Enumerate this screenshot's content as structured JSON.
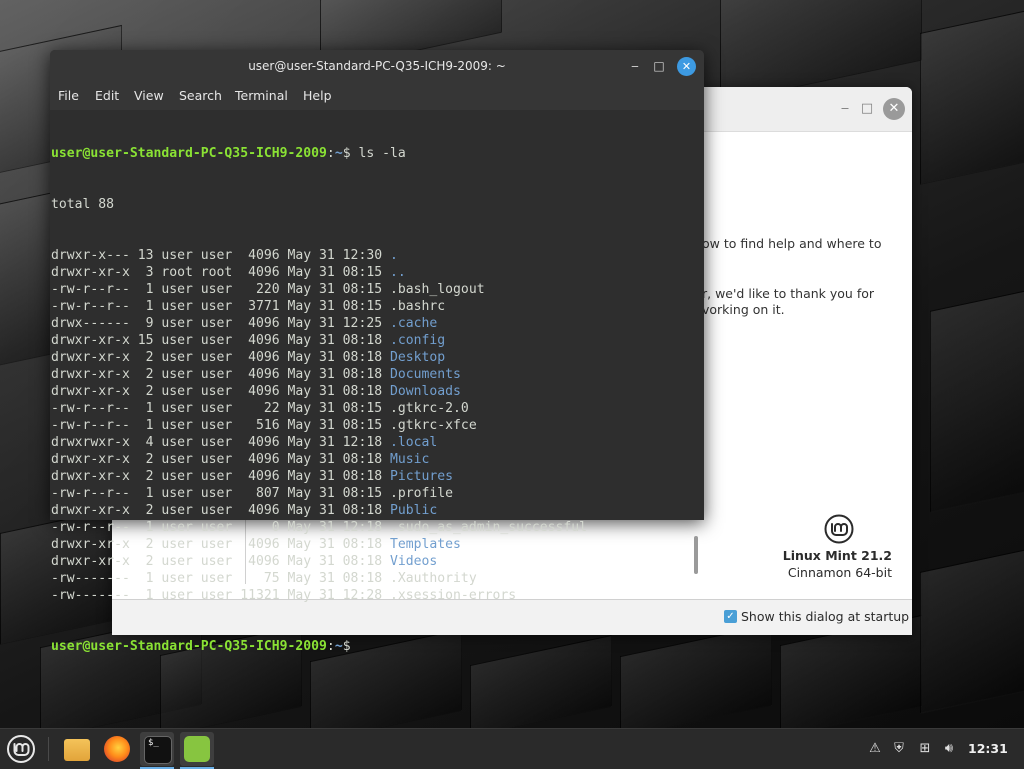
{
  "terminal": {
    "title": "user@user-Standard-PC-Q35-ICH9-2009: ~",
    "menu": [
      "File",
      "Edit",
      "View",
      "Search",
      "Terminal",
      "Help"
    ],
    "prompt_user": "user@user-Standard-PC-Q35-ICH9-2009",
    "prompt_path": "~",
    "command": "ls -la",
    "total": "total 88",
    "listing": [
      {
        "meta": "drwxr-x--- 13 user user  4096 May 31 12:30 ",
        "name": ".",
        "dir": true
      },
      {
        "meta": "drwxr-xr-x  3 root root  4096 May 31 08:15 ",
        "name": "..",
        "dir": true
      },
      {
        "meta": "-rw-r--r--  1 user user   220 May 31 08:15 ",
        "name": ".bash_logout",
        "dir": false
      },
      {
        "meta": "-rw-r--r--  1 user user  3771 May 31 08:15 ",
        "name": ".bashrc",
        "dir": false
      },
      {
        "meta": "drwx------  9 user user  4096 May 31 12:25 ",
        "name": ".cache",
        "dir": true
      },
      {
        "meta": "drwxr-xr-x 15 user user  4096 May 31 08:18 ",
        "name": ".config",
        "dir": true
      },
      {
        "meta": "drwxr-xr-x  2 user user  4096 May 31 08:18 ",
        "name": "Desktop",
        "dir": true
      },
      {
        "meta": "drwxr-xr-x  2 user user  4096 May 31 08:18 ",
        "name": "Documents",
        "dir": true
      },
      {
        "meta": "drwxr-xr-x  2 user user  4096 May 31 08:18 ",
        "name": "Downloads",
        "dir": true
      },
      {
        "meta": "-rw-r--r--  1 user user    22 May 31 08:15 ",
        "name": ".gtkrc-2.0",
        "dir": false
      },
      {
        "meta": "-rw-r--r--  1 user user   516 May 31 08:15 ",
        "name": ".gtkrc-xfce",
        "dir": false
      },
      {
        "meta": "drwxrwxr-x  4 user user  4096 May 31 12:18 ",
        "name": ".local",
        "dir": true
      },
      {
        "meta": "drwxr-xr-x  2 user user  4096 May 31 08:18 ",
        "name": "Music",
        "dir": true
      },
      {
        "meta": "drwxr-xr-x  2 user user  4096 May 31 08:18 ",
        "name": "Pictures",
        "dir": true
      },
      {
        "meta": "-rw-r--r--  1 user user   807 May 31 08:15 ",
        "name": ".profile",
        "dir": false
      },
      {
        "meta": "drwxr-xr-x  2 user user  4096 May 31 08:18 ",
        "name": "Public",
        "dir": true
      },
      {
        "meta": "-rw-r--r--  1 user user     0 May 31 12:18 ",
        "name": ".sudo_as_admin_successful",
        "dir": false
      },
      {
        "meta": "drwxr-xr-x  2 user user  4096 May 31 08:18 ",
        "name": "Templates",
        "dir": true
      },
      {
        "meta": "drwxr-xr-x  2 user user  4096 May 31 08:18 ",
        "name": "Videos",
        "dir": true
      },
      {
        "meta": "-rw-------  1 user user    75 May 31 08:18 ",
        "name": ".Xauthority",
        "dir": false
      },
      {
        "meta": "-rw-------  1 user user 11321 May 31 12:28 ",
        "name": ".xsession-errors",
        "dir": false
      }
    ],
    "colors": {
      "prompt_user": "#8ae234",
      "prompt_path": "#729fcf",
      "directory": "#729fcf",
      "text": "#d3d7cf",
      "background": "#2e2e2e"
    }
  },
  "welcome": {
    "partial_text_1": "ow to find help and where to",
    "partial_text_2": "r, we'd like to thank you for",
    "partial_text_3": "vorking on it.",
    "distro_name": "Linux Mint 21.2",
    "edition": "Cinnamon 64-bit",
    "startup_checkbox_label": "Show this dialog at startup",
    "startup_checkbox_checked": true,
    "min_glyph": "‒",
    "max_glyph": "□",
    "close_glyph": "✕"
  },
  "taskbar": {
    "apps": [
      {
        "name": "files",
        "icon": "folder-icon"
      },
      {
        "name": "firefox",
        "icon": "firefox-icon"
      },
      {
        "name": "terminal",
        "icon": "terminal-icon",
        "glyph": "$_"
      },
      {
        "name": "mint-welcome",
        "icon": "mint-logo-icon"
      }
    ],
    "clock": "12:31",
    "accent_color": "#6ab0e8"
  }
}
